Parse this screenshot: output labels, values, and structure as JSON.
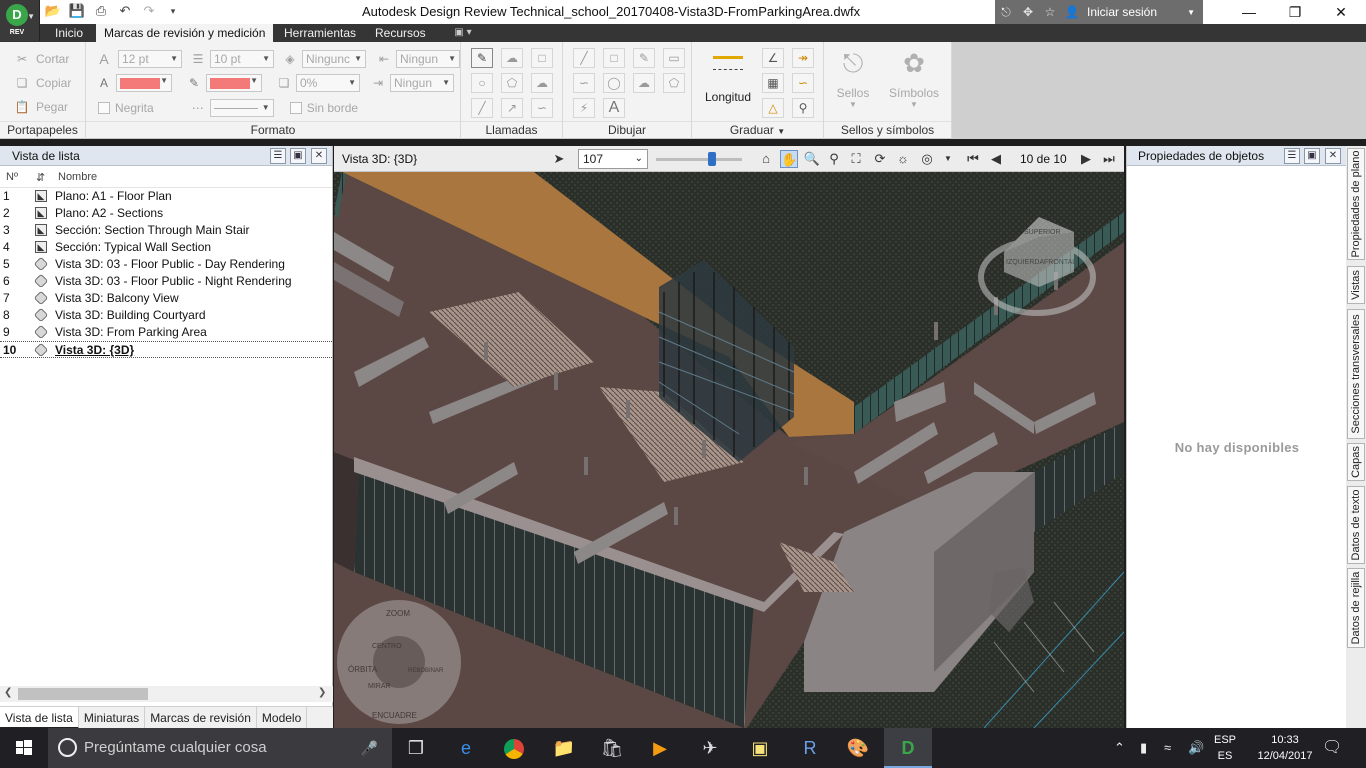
{
  "app": {
    "logo_letter": "D",
    "logo_sub": "REV",
    "title": "Autodesk Design Review   Technical_school_20170408-Vista3D-FromParkingArea.dwfx",
    "sign_in": "Iniciar sesión"
  },
  "tabs": [
    "Inicio",
    "Marcas de revisión y medición",
    "Herramientas",
    "Recursos"
  ],
  "ribbon": {
    "portapapeles": {
      "label": "Portapapeles",
      "cut": "Cortar",
      "copy": "Copiar",
      "paste": "Pegar"
    },
    "formato": {
      "label": "Formato",
      "font_size": "12 pt",
      "line_size": "10 pt",
      "fill": "Ningunc",
      "transparency": "0%",
      "start_arrow": "Ningun",
      "end_arrow": "Ningun",
      "bold": "Negrita",
      "no_border": "Sin borde",
      "accent_color": "#f47a7a"
    },
    "llamadas": {
      "label": "Llamadas"
    },
    "dibujar": {
      "label": "Dibujar",
      "text_tool": "A"
    },
    "graduar": {
      "label": "Graduar",
      "length": "Longitud"
    },
    "sellos": {
      "label": "Sellos y símbolos",
      "stamps": "Sellos",
      "symbols": "Símbolos"
    }
  },
  "list_view": {
    "title": "Vista de lista",
    "col_num": "Nº",
    "col_name": "Nombre",
    "rows": [
      {
        "num": "1",
        "name": "Plano: A1 - Floor Plan",
        "icon": "sheet-icon"
      },
      {
        "num": "2",
        "name": "Plano: A2 - Sections",
        "icon": "sheet-icon"
      },
      {
        "num": "3",
        "name": "Sección: Section Through Main Stair",
        "icon": "sheet-icon"
      },
      {
        "num": "4",
        "name": "Sección: Typical Wall Section",
        "icon": "sheet-icon"
      },
      {
        "num": "5",
        "name": "Vista 3D: 03 - Floor Public - Day Rendering",
        "icon": "3d-view-icon"
      },
      {
        "num": "6",
        "name": "Vista 3D: 03 - Floor Public - Night Rendering",
        "icon": "3d-view-icon"
      },
      {
        "num": "7",
        "name": "Vista 3D: Balcony View",
        "icon": "3d-view-icon"
      },
      {
        "num": "8",
        "name": "Vista 3D: Building Courtyard",
        "icon": "3d-view-icon"
      },
      {
        "num": "9",
        "name": "Vista 3D: From Parking Area",
        "icon": "3d-view-icon"
      },
      {
        "num": "10",
        "name": "Vista 3D: {3D}",
        "icon": "3d-view-icon"
      }
    ],
    "bottom_tabs": [
      "Vista de lista",
      "Miniaturas",
      "Marcas de revisión",
      "Modelo"
    ]
  },
  "viewport": {
    "title": "Vista 3D: {3D}",
    "zoom": "107",
    "page_indicator": "10 de 10",
    "viewcube_labels": [
      "SUPERIOR",
      "IZQUIERDA",
      "FRONTAL"
    ],
    "wheel_labels": [
      "ZOOM",
      "ÓRBITA",
      "ENCUADRE",
      "CENTRO",
      "MIRAR",
      "REBOBINAR"
    ]
  },
  "properties": {
    "title": "Propiedades de objetos",
    "empty": "No hay disponibles"
  },
  "side_tabs": [
    "Propiedades de plano",
    "Vistas",
    "Secciones transversales",
    "Capas",
    "Datos de texto",
    "Datos de rejilla"
  ],
  "taskbar": {
    "search": "Pregúntame cualquier cosa",
    "lang_top": "ESP",
    "lang_bottom": "ES",
    "time": "10:33",
    "date": "12/04/2017"
  }
}
